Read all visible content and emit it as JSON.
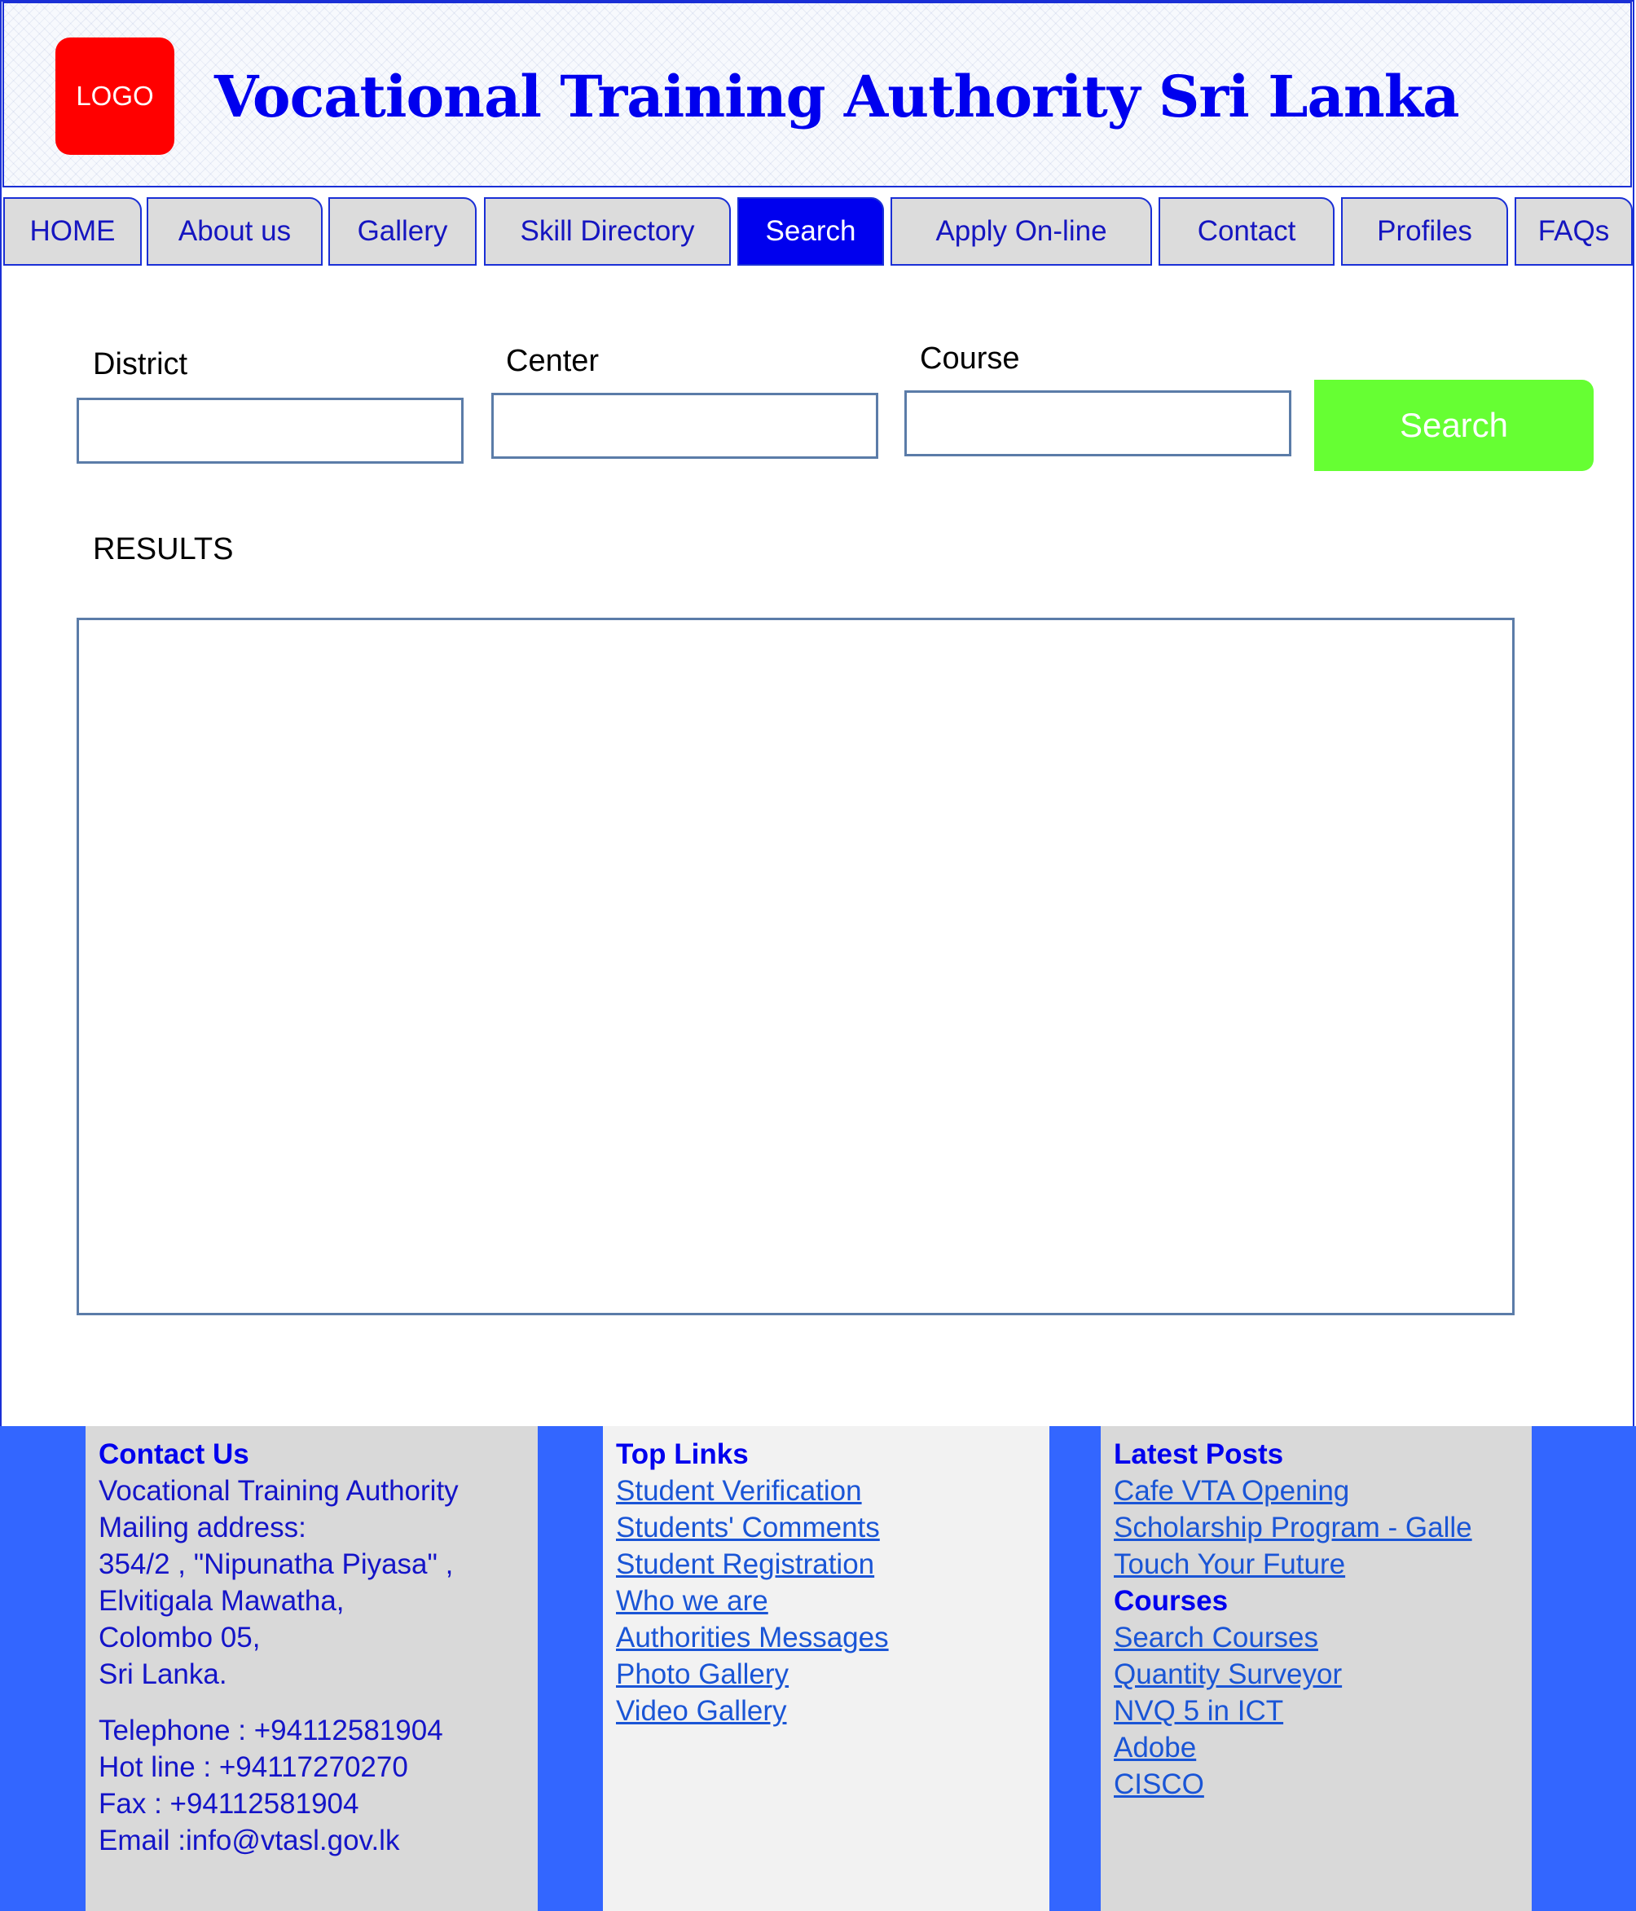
{
  "header": {
    "logo_text": "LOGO",
    "title": "Vocational Training Authority Sri Lanka"
  },
  "nav": {
    "tabs": [
      {
        "label": "HOME"
      },
      {
        "label": "About us"
      },
      {
        "label": "Gallery"
      },
      {
        "label": "Skill Directory"
      },
      {
        "label": "Search",
        "active": true
      },
      {
        "label": "Apply On-line"
      },
      {
        "label": "Contact"
      },
      {
        "label": "Profiles"
      },
      {
        "label": "FAQs"
      }
    ]
  },
  "search_form": {
    "district_label": "District",
    "center_label": "Center",
    "course_label": "Course",
    "district_value": "",
    "center_value": "",
    "course_value": "",
    "search_button": "Search"
  },
  "results": {
    "heading": "RESULTS"
  },
  "footer": {
    "contact": {
      "title": "Contact Us",
      "lines": [
        "Vocational Training Authority",
        "Mailing address:",
        "354/2 , \"Nipunatha Piyasa\" ,",
        "Elvitigala Mawatha,",
        "Colombo 05,",
        "Sri Lanka."
      ],
      "telephone": "Telephone : +94112581904",
      "hotline": "Hot line : +94117270270",
      "fax": "Fax : +94112581904",
      "email": "Email :info@vtasl.gov.lk"
    },
    "top_links": {
      "title": "Top Links",
      "links": [
        "Student Verification",
        "Students' Comments",
        "Student Registration",
        "Who we are",
        "Authorities Messages",
        "Photo Gallery",
        "Video Gallery"
      ]
    },
    "latest_posts": {
      "title": "Latest Posts",
      "links": [
        "Cafe VTA Opening",
        "Scholarship Program - Galle",
        "Touch Your Future"
      ]
    },
    "courses": {
      "title": "Courses",
      "links": [
        "Search Courses",
        "Quantity Surveyor",
        "NVQ 5 in ICT",
        "Adobe",
        "CISCO"
      ]
    }
  }
}
